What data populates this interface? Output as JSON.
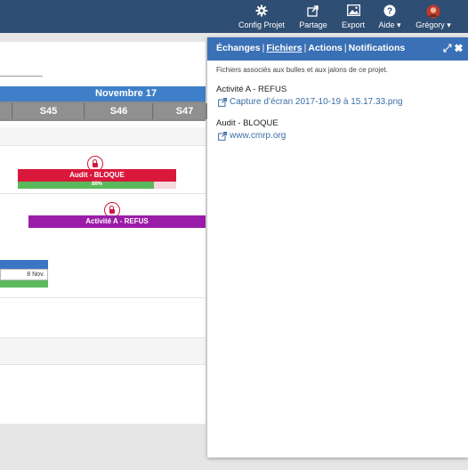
{
  "nav": {
    "config": "Config Projet",
    "share": "Partage",
    "export": "Export",
    "help": "Aide ▾",
    "user": "Grégory ▾"
  },
  "gantt": {
    "month": "Novembre 17",
    "weeks": [
      "S45",
      "S46",
      "S47"
    ],
    "bars": [
      {
        "label": "Audit - BLOQUE",
        "progress_label": "86%",
        "progress": 0.86,
        "color": "#d9183b"
      },
      {
        "label": "Activité A - REFUS",
        "color": "#9b1ca8"
      },
      {
        "label": "",
        "date": "8 Nov.",
        "color": "#3a76c4"
      }
    ]
  },
  "panel": {
    "tabs": [
      "Échanges",
      "Fichiers",
      "Actions",
      "Notifications"
    ],
    "active_tab": "Fichiers",
    "description": "Fichiers associés aux bulles et aux jalons de ce projet.",
    "groups": [
      {
        "title": "Activité A - REFUS",
        "link": "Capture d’écran 2017-10-19 à 15.17.33.png"
      },
      {
        "title": "Audit - BLOQUE",
        "link": "www.cmrp.org"
      }
    ],
    "expand": "⤢",
    "close": "✖"
  }
}
